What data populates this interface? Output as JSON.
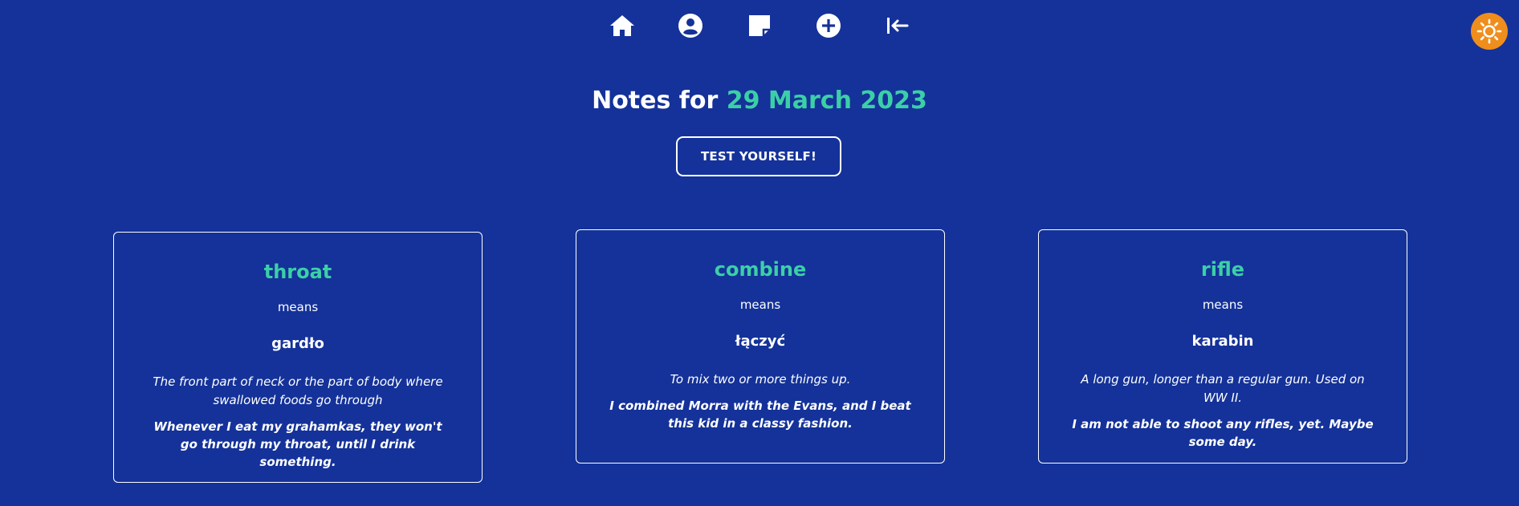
{
  "nav": {
    "items": [
      {
        "icon": "home-icon"
      },
      {
        "icon": "user-icon"
      },
      {
        "icon": "note-icon"
      },
      {
        "icon": "add-icon"
      },
      {
        "icon": "logout-icon"
      }
    ],
    "theme_toggle_icon": "sun-icon"
  },
  "heading": {
    "prefix": "Notes for",
    "date": "29 March 2023"
  },
  "test_button_label": "TEST YOURSELF!",
  "cards": [
    {
      "word": "throat",
      "means": "means",
      "translation": "gardło",
      "definition": "The front part of neck or the part of body where swallowed foods go through",
      "example": "Whenever I eat my grahamkas, they won't go through my throat, until I drink something."
    },
    {
      "word": "combine",
      "means": "means",
      "translation": "łączyć",
      "definition": "To mix two or more things up.",
      "example": "I combined Morra with the Evans, and I beat this kid in a classy fashion."
    },
    {
      "word": "rifle",
      "means": "means",
      "translation": "karabin",
      "definition": "A long gun, longer than a regular gun. Used on WW II.",
      "example": "I am not able to shoot any rifles, yet. Maybe some day."
    }
  ],
  "colors": {
    "background": "#143299",
    "accent": "#3ccfa7",
    "theme_toggle": "#ef8e1c",
    "text": "#ffffff"
  }
}
